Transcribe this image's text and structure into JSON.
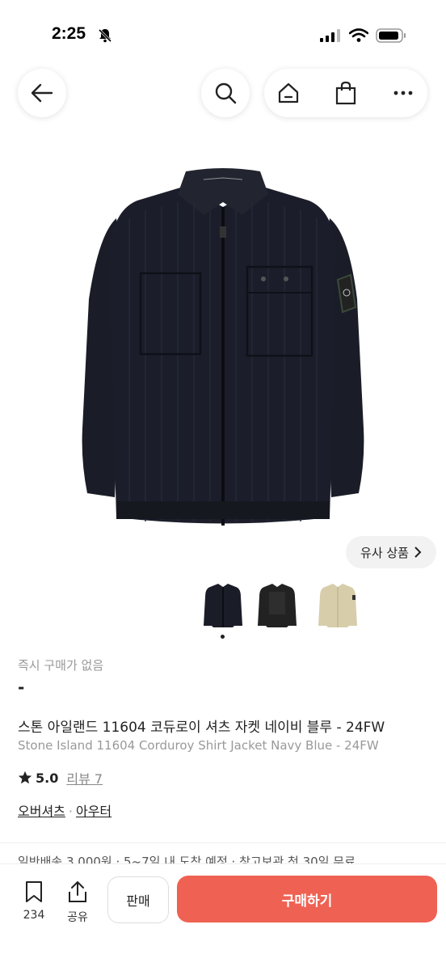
{
  "status_bar": {
    "time": "2:25"
  },
  "product": {
    "similar_label": "유사 상품",
    "instant_purchase": "즉시 구매가 없음",
    "price": "-",
    "title_kr": "스톤 아일랜드 11604 코듀로이 셔츠 자켓 네이비 블루 - 24FW",
    "title_en": "Stone Island 11604 Corduroy Shirt Jacket Navy Blue - 24FW",
    "rating": "5.0",
    "review_label": "리뷰 7",
    "categories": [
      "오버셔츠",
      "아우터"
    ],
    "category_sep": "·"
  },
  "shipping_peek": "일반배송 3,000원 · 5~7일 내 도착 예정 · 창고보관 첫 30일 무료",
  "bottom_bar": {
    "wish_count": "234",
    "share_label": "공유",
    "sell_label": "판매",
    "buy_label": "구매하기"
  },
  "colors": {
    "buy": "#ef6253",
    "jacket": "#1a1d28"
  },
  "icons": [
    "back-arrow-icon",
    "search-icon",
    "home-icon",
    "shopping-bag-icon",
    "more-icon",
    "bookmark-icon",
    "share-icon",
    "star-icon",
    "chevron-right-icon"
  ]
}
